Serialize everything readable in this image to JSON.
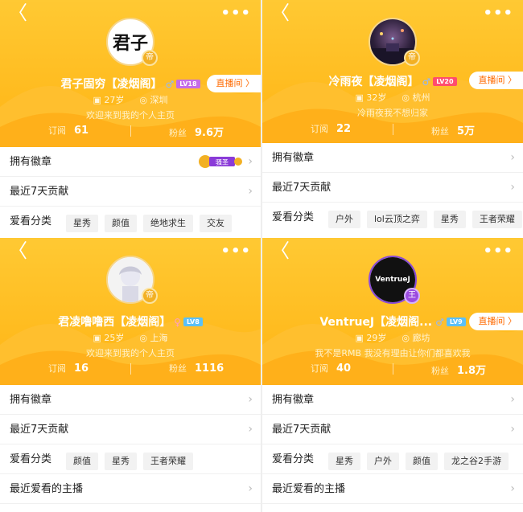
{
  "common": {
    "back_glyph": "〈",
    "more_glyph": "•••",
    "live_label": "直播间 〉",
    "sub_label": "订阅",
    "fan_label": "粉丝",
    "medal_row": "拥有徽章",
    "contrib_row": "最近7天贡献",
    "category_row": "爱看分类",
    "recent_row": "最近爱看的主播",
    "chevron": "›",
    "badge_glyph": "帝",
    "gender_glyph": "♂"
  },
  "profiles": [
    {
      "name": "君子固穷【凌烟阁】",
      "level": "LV18",
      "level_color": "#c56be8",
      "age": "27岁",
      "city": "深圳",
      "bio": "欢迎来到我的个人主页",
      "subs": "61",
      "fans": "9.6万",
      "tags": [
        "星秀",
        "颜值",
        "绝地求生",
        "交友"
      ],
      "medal_text": "骚圣",
      "avatar_text": "君子"
    },
    {
      "name": "冷雨夜【凌烟阁】",
      "level": "LV20",
      "level_color": "#ff4d6d",
      "age": "32岁",
      "city": "杭州",
      "bio": "冷雨夜我不想归家",
      "subs": "22",
      "fans": "5万",
      "tags": [
        "户外",
        "lol云顶之弈",
        "星秀",
        "王者荣耀"
      ],
      "avatar_text": ""
    },
    {
      "name": "君凌噜噜西【凌烟阁】",
      "level": "LV8",
      "level_color": "#5bc0f8",
      "age": "25岁",
      "city": "上海",
      "bio": "欢迎来到我的个人主页",
      "subs": "16",
      "fans": "1116",
      "tags": [
        "颜值",
        "星秀",
        "王者荣耀"
      ],
      "avatar_text": ""
    },
    {
      "name": "VentrueJ【凌烟阁...",
      "level": "LV9",
      "level_color": "#5bc0f8",
      "age": "29岁",
      "city": "廊坊",
      "bio": "我不是RMB 我没有理由让你们都喜欢我",
      "subs": "40",
      "fans": "1.8万",
      "tags": [
        "星秀",
        "户外",
        "颜值",
        "龙之谷2手游"
      ],
      "avatar_text": "VentrueJ"
    }
  ]
}
